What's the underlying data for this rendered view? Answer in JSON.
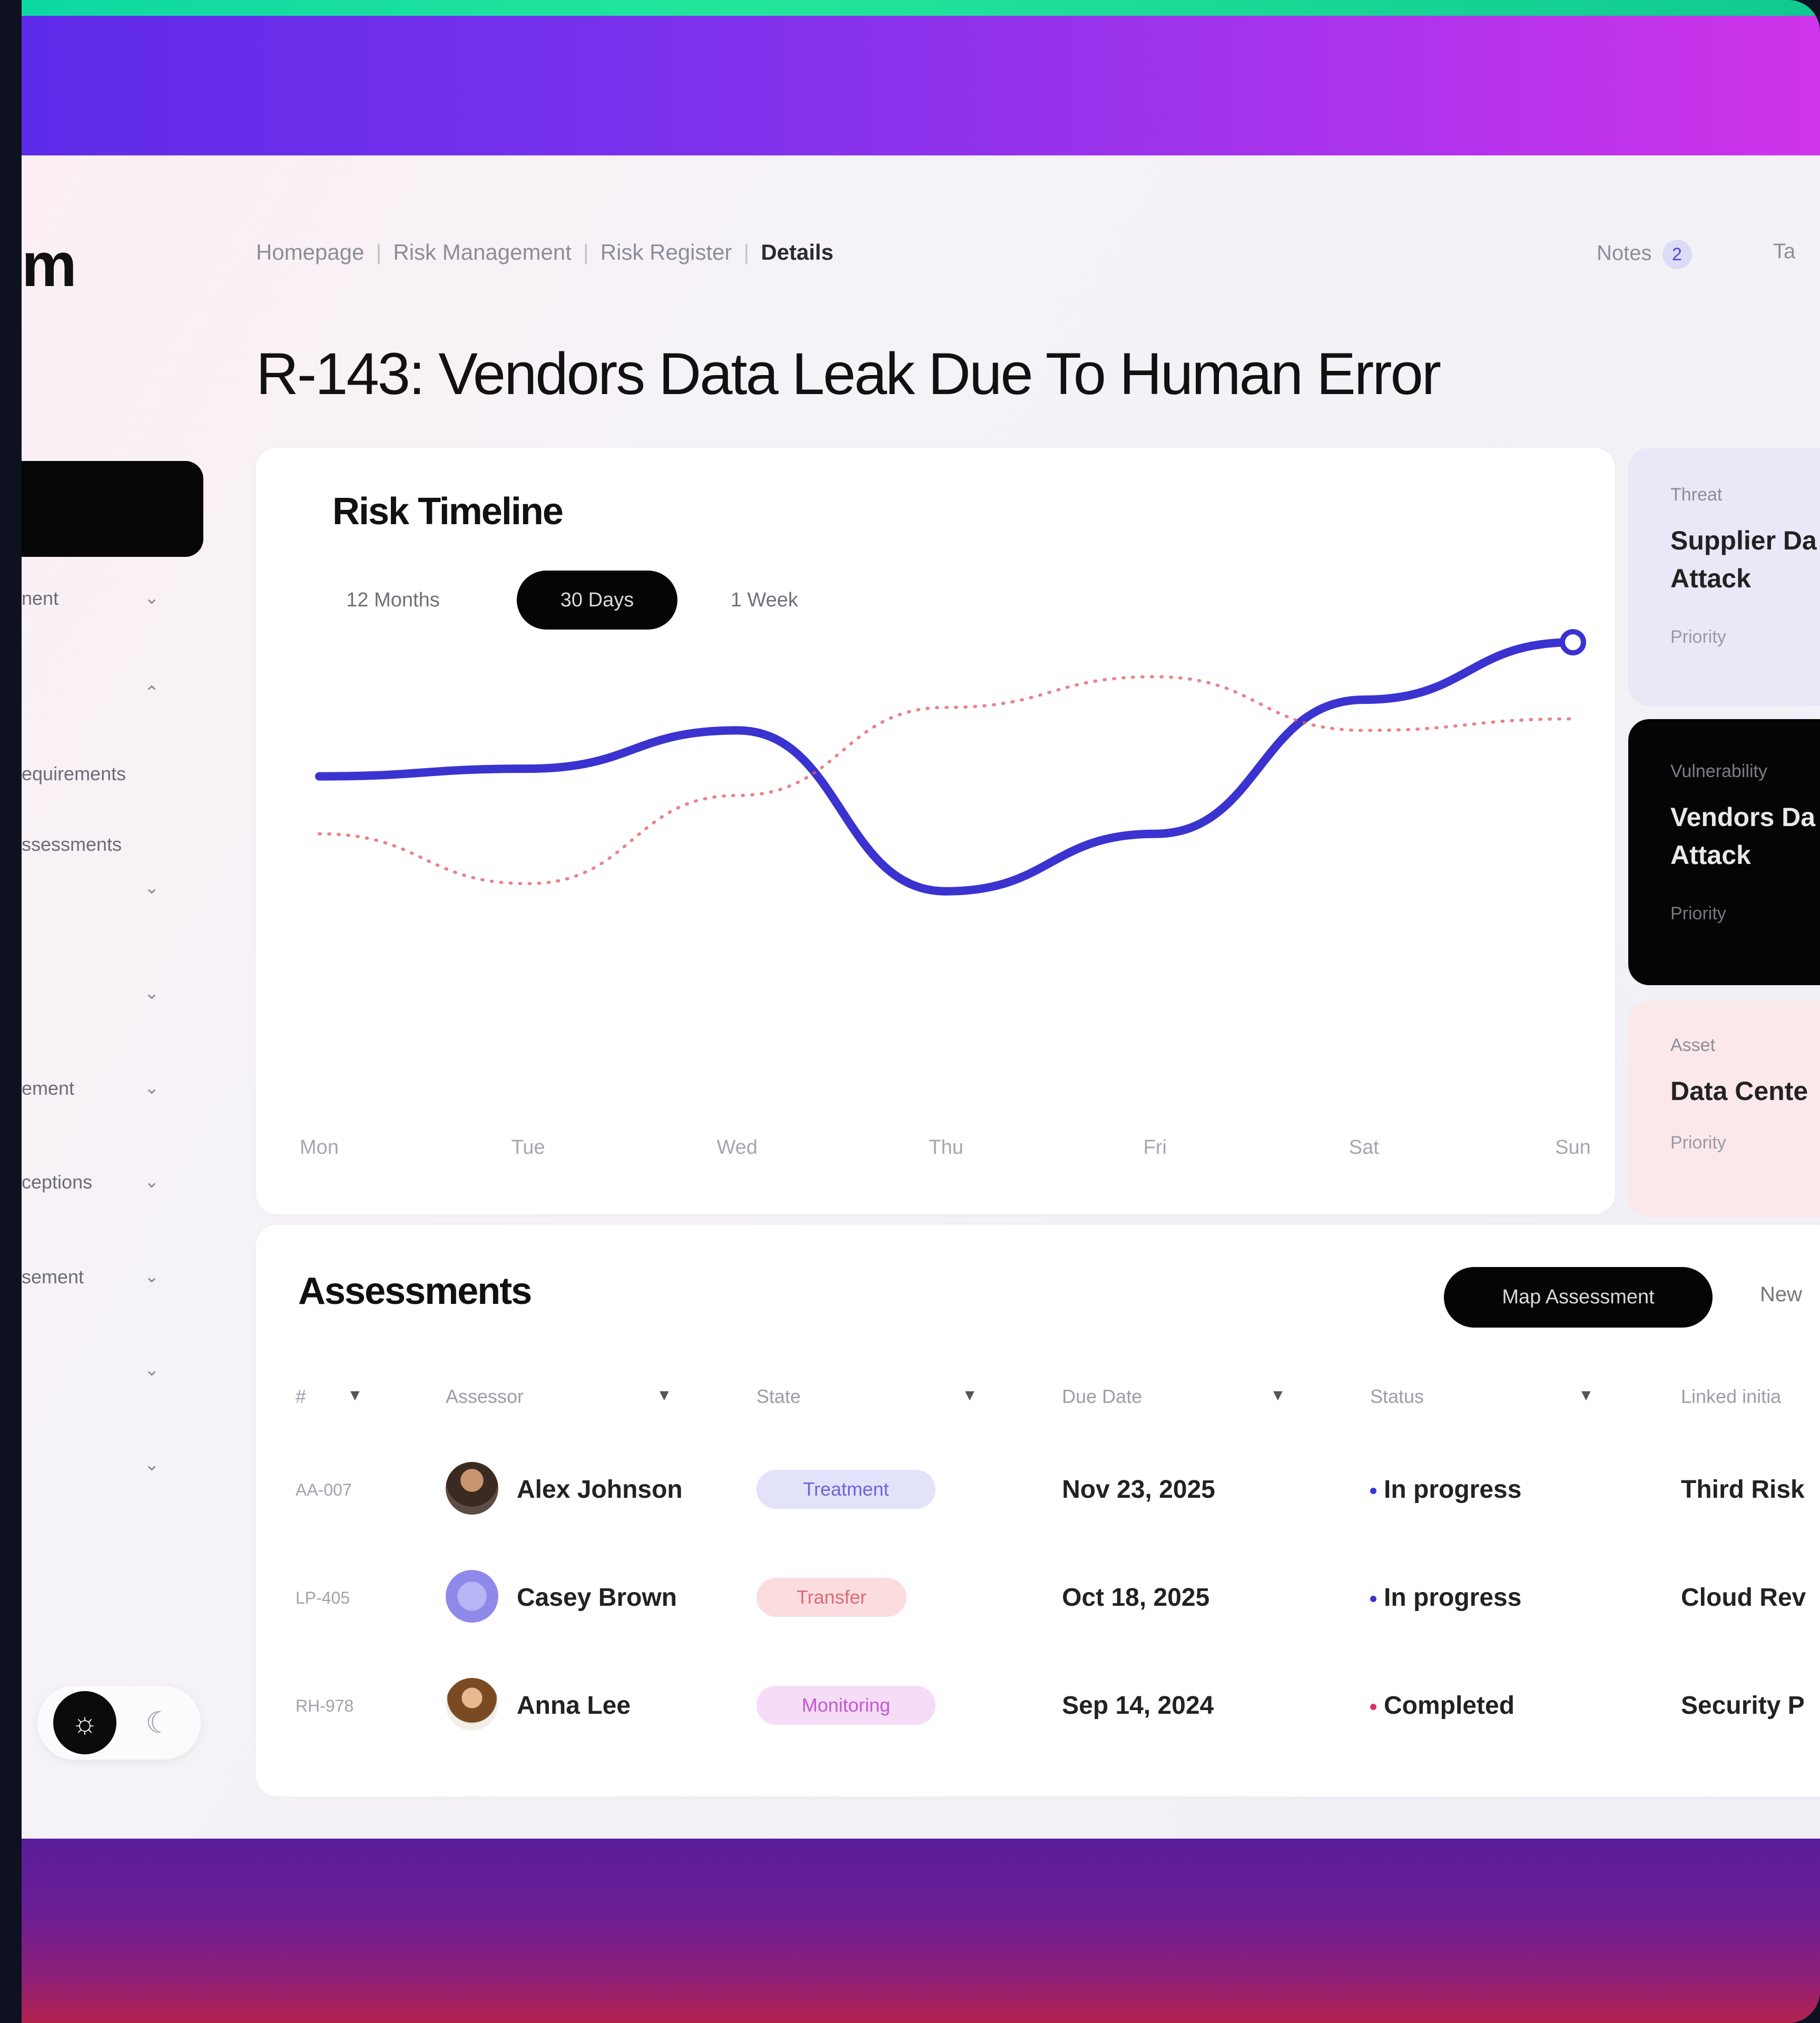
{
  "sidebar": {
    "logo": "m",
    "items": [
      {
        "label": "nent"
      },
      {
        "label": ""
      },
      {
        "label": "equirements"
      },
      {
        "label": "ssessments"
      },
      {
        "label": ""
      },
      {
        "label": ""
      },
      {
        "label": "ement"
      },
      {
        "label": "ceptions"
      },
      {
        "label": "sement"
      },
      {
        "label": ""
      },
      {
        "label": ""
      }
    ]
  },
  "header": {
    "breadcrumb": [
      "Homepage",
      "Risk Management",
      "Risk Register",
      "Details"
    ],
    "notes_label": "Notes",
    "notes_count": "2",
    "tab_cut": "Ta",
    "title": "R-143: Vendors Data Leak Due To Human Error"
  },
  "risk_timeline": {
    "title": "Risk Timeline",
    "ranges": [
      "12 Months",
      "30 Days",
      "1 Week"
    ],
    "selected_range": "30 Days"
  },
  "chart_data": {
    "type": "line",
    "categories": [
      "Mon",
      "Tue",
      "Wed",
      "Thu",
      "Fri",
      "Sat",
      "Sun"
    ],
    "series": [
      {
        "style": "solid",
        "color": "#3a33d0",
        "values": [
          60,
          62,
          72,
          30,
          45,
          80,
          95
        ]
      },
      {
        "style": "dotted",
        "color": "#e35a62",
        "values": [
          45,
          32,
          55,
          78,
          86,
          72,
          75
        ]
      }
    ],
    "ylim": [
      0,
      110
    ],
    "grid": false,
    "legend": "none"
  },
  "side_cards": [
    {
      "label": "Threat",
      "value": "Supplier Da Attack",
      "priority": "Priority"
    },
    {
      "label": "Vulnerability",
      "value": "Vendors Da Attack",
      "priority": "Priority"
    },
    {
      "label": "Asset",
      "value": "Data Cente",
      "priority": "Priority"
    }
  ],
  "assessments": {
    "title": "Assessments",
    "map_button": "Map Assessment",
    "new_button": "New",
    "columns": [
      "#",
      "Assessor",
      "State",
      "Due Date",
      "Status",
      "Linked initia"
    ],
    "rows": [
      {
        "id": "AA-007",
        "assessor": "Alex Johnson",
        "state": "Treatment",
        "due": "Nov 23, 2025",
        "status": "In progress",
        "linked": "Third Risk"
      },
      {
        "id": "LP-405",
        "assessor": "Casey Brown",
        "state": "Transfer",
        "due": "Oct 18, 2025",
        "status": "In progress",
        "linked": "Cloud Rev"
      },
      {
        "id": "RH-978",
        "assessor": "Anna Lee",
        "state": "Monitoring",
        "due": "Sep 14, 2024",
        "status": "Completed",
        "linked": "Security P"
      }
    ]
  }
}
